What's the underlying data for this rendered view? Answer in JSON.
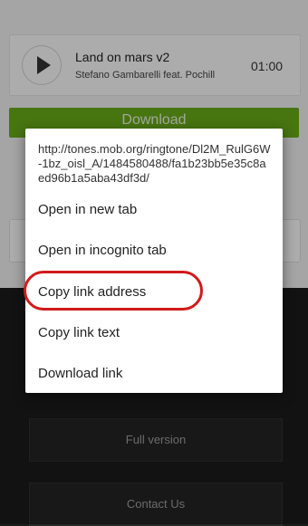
{
  "track": {
    "title": "Land on mars v2",
    "artist": "Stefano Gambarelli feat. Pochill",
    "duration": "01:00"
  },
  "download_button": {
    "label": "Download"
  },
  "dark_section": {
    "full_version_label": "Full version",
    "contact_us_label": "Contact Us"
  },
  "context_menu": {
    "url": "http://tones.mob.org/ringtone/Dl2M_RulG6W-1bz_oisl_A/1484580488/fa1b23bb5e35c8aed96b1a5aba43df3d/",
    "items": [
      {
        "label": "Open in new tab"
      },
      {
        "label": "Open in incognito tab"
      },
      {
        "label": "Copy link address",
        "highlighted": true
      },
      {
        "label": "Copy link text"
      },
      {
        "label": "Download link"
      }
    ]
  },
  "colors": {
    "download_green": "#66a818",
    "highlight_red": "#d11a1a"
  }
}
